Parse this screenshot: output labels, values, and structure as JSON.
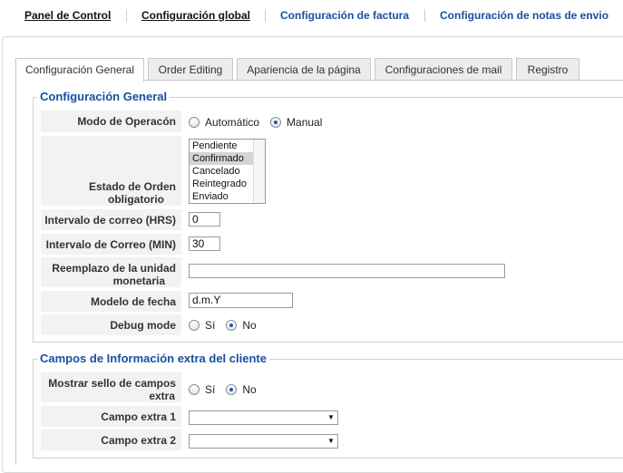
{
  "topnav": [
    {
      "label": "Panel de Control"
    },
    {
      "label": "Configuración global"
    },
    {
      "label": "Configuración de factura"
    },
    {
      "label": "Configuración de notas de envio"
    }
  ],
  "tabs": [
    {
      "label": "Configuración General",
      "active": true
    },
    {
      "label": "Order Editing"
    },
    {
      "label": "Apariencia de la página"
    },
    {
      "label": "Configuraciones de mail"
    },
    {
      "label": "Registro"
    }
  ],
  "general": {
    "legend": "Configuración General",
    "modo": {
      "label": "Modo de Operacón",
      "options": [
        "Automático",
        "Manual"
      ],
      "selected": "Manual"
    },
    "estado": {
      "label_line1": "Estado de Orden",
      "label_line2": "obligatorio",
      "options": [
        "Pendiente",
        "Confirmado",
        "Cancelado",
        "Reintegrado",
        "Enviado"
      ],
      "selected": "Confirmado"
    },
    "intervalo_hrs": {
      "label": "Intervalo de correo (HRS)",
      "value": "0"
    },
    "intervalo_min": {
      "label": "Intervalo de Correo (MIN)",
      "value": "30"
    },
    "reemplazo": {
      "label_line1": "Reemplazo de la unidad",
      "label_line2": "monetaria",
      "value": ""
    },
    "modelo_fecha": {
      "label": "Modelo de fecha",
      "value": "d.m.Y"
    },
    "debug": {
      "label": "Debug mode",
      "options": [
        "Sí",
        "No"
      ],
      "selected": "No"
    }
  },
  "extra": {
    "legend": "Campos de Información extra del cliente",
    "mostrar": {
      "label_line1": "Mostrar sello de campos",
      "label_line2": "extra",
      "options": [
        "Sí",
        "No"
      ],
      "selected": "No"
    },
    "campo1": {
      "label": "Campo extra 1",
      "value": ""
    },
    "campo2": {
      "label": "Campo extra 2",
      "value": ""
    }
  }
}
